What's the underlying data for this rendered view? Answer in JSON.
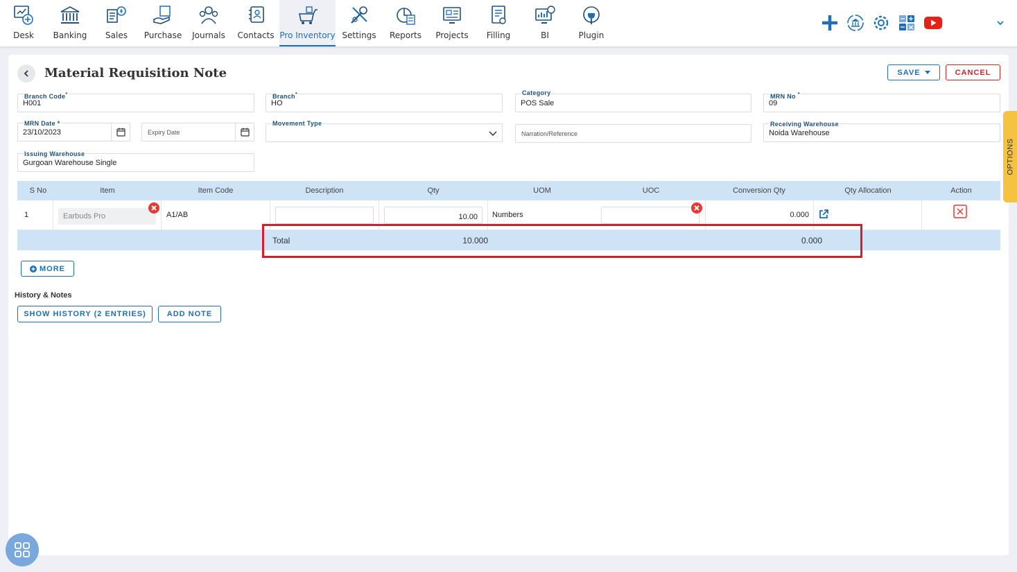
{
  "nav": {
    "items": [
      {
        "label": "Desk",
        "icon": "desk-icon"
      },
      {
        "label": "Banking",
        "icon": "bank-icon"
      },
      {
        "label": "Sales",
        "icon": "sales-icon"
      },
      {
        "label": "Purchase",
        "icon": "purchase-icon"
      },
      {
        "label": "Journals",
        "icon": "journals-icon"
      },
      {
        "label": "Contacts",
        "icon": "contacts-icon"
      },
      {
        "label": "Pro Inventory",
        "icon": "inventory-icon"
      },
      {
        "label": "Settings",
        "icon": "settings-tools-icon"
      },
      {
        "label": "Reports",
        "icon": "reports-icon"
      },
      {
        "label": "Projects",
        "icon": "projects-icon"
      },
      {
        "label": "Filling",
        "icon": "filling-icon"
      },
      {
        "label": "BI",
        "icon": "bi-icon"
      },
      {
        "label": "Plugin",
        "icon": "plugin-icon"
      }
    ],
    "active": "Pro Inventory",
    "tools": [
      "plus-icon",
      "bank-sync-icon",
      "gear-icon",
      "calculator-icon",
      "youtube-icon",
      "chevron-down-icon"
    ]
  },
  "page": {
    "title": "Material Requisition Note",
    "save_label": "SAVE",
    "cancel_label": "CANCEL"
  },
  "form": {
    "branch_code": {
      "label": "Branch Code",
      "value": "H001"
    },
    "branch": {
      "label": "Branch",
      "value": "HO"
    },
    "category": {
      "label": "Category",
      "value": "POS Sale"
    },
    "mrn_no": {
      "label": "MRN No",
      "value": "09"
    },
    "mrn_date": {
      "label": "MRN Date",
      "value": "23/10/2023"
    },
    "expiry_date": {
      "placeholder": "Expiry Date"
    },
    "movement_type": {
      "label": "Movement Type",
      "value": ""
    },
    "narration": {
      "placeholder": "Narration/Reference"
    },
    "receiving_warehouse": {
      "label": "Receiving Warehouse",
      "value": "Noida Warehouse"
    },
    "issuing_warehouse": {
      "label": "Issuing Warehouse",
      "value": "Gurgoan Warehouse Single"
    }
  },
  "table": {
    "headers": [
      "S No",
      "Item",
      "Item Code",
      "Description",
      "Qty",
      "UOM",
      "UOC",
      "Conversion Qty",
      "Qty Allocation",
      "Action"
    ],
    "rows": [
      {
        "sno": "1",
        "item": "Earbuds Pro",
        "item_code": "A1/AB",
        "description": "",
        "qty": "10.00",
        "uom": "Numbers",
        "uoc": "",
        "conversion_qty": "0.000"
      }
    ],
    "total_label": "Total",
    "total_qty": "10.000",
    "total_conversion": "0.000"
  },
  "more_label": "MORE",
  "history": {
    "title": "History & Notes",
    "show_history_label": "SHOW HISTORY (2 ENTRIES)",
    "add_note_label": "ADD NOTE"
  },
  "options_label": "OPTIONS",
  "colors": {
    "accent": "#1f6fb2",
    "danger": "#c62828",
    "highlight": "#d4202a",
    "options": "#f5c242",
    "table_header": "#cfe3f7"
  }
}
